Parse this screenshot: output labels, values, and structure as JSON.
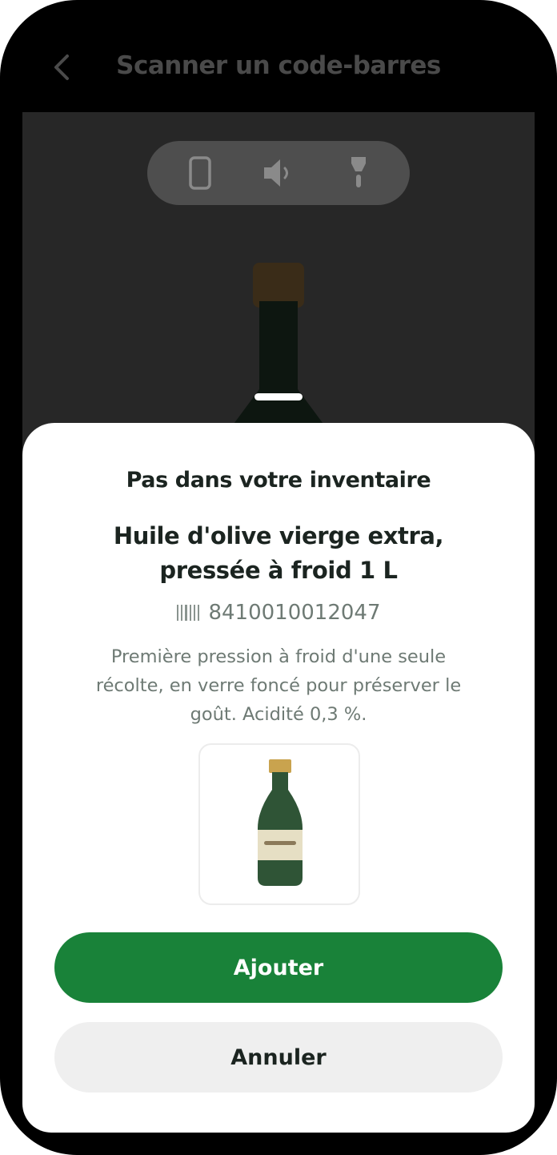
{
  "header": {
    "title": "Scanner un code-barres",
    "back_icon": "chevron-left-icon"
  },
  "camera_controls": {
    "items": [
      {
        "icon": "phone-icon"
      },
      {
        "icon": "speaker-icon"
      },
      {
        "icon": "flashlight-icon"
      }
    ]
  },
  "sheet": {
    "status": "Pas dans votre inventaire",
    "product_name": "Huile d'olive vierge extra, pressée à froid 1 L",
    "barcode": "8410010012047",
    "description": "Première pression à froid d'une seule récolte, en verre foncé pour préserver le goût. Acidité 0,3 %.",
    "image_icon": "olive-oil-bottle-icon",
    "add_label": "Ajouter",
    "cancel_label": "Annuler"
  },
  "colors": {
    "primary": "#198239",
    "secondary_button": "#efefef",
    "bottle_green": "#2f5436",
    "bottle_cap": "#c9a34e",
    "bottle_label": "#e6dfc4"
  }
}
